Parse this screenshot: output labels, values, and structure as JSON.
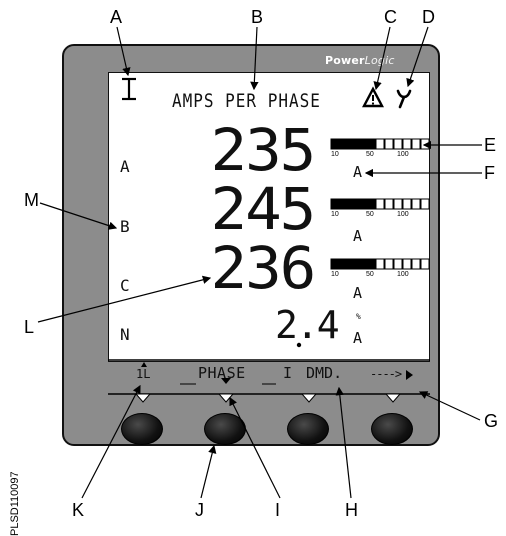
{
  "brand": {
    "bold": "Power",
    "light": "Logic"
  },
  "title": "AMPS PER PHASE",
  "phases": [
    {
      "label": "A",
      "value": "235",
      "unit": "A"
    },
    {
      "label": "B",
      "value": "245",
      "unit": "A"
    },
    {
      "label": "C",
      "value": "236",
      "unit": "A"
    },
    {
      "label": "N",
      "value": "2.4",
      "unit": "A"
    }
  ],
  "n_percent_symbol": "%",
  "bargraph_scale": [
    "10",
    "50",
    "100"
  ],
  "bargraph_levels": [
    0.45,
    0.45,
    0.45
  ],
  "menu": {
    "left": "1L",
    "phase": "PHASE",
    "i": "I",
    "dmd": "DMD.",
    "more": "---->"
  },
  "callouts": [
    "A",
    "B",
    "C",
    "D",
    "E",
    "F",
    "G",
    "H",
    "I",
    "J",
    "K",
    "L",
    "M"
  ],
  "side_label": "PLSD110097"
}
